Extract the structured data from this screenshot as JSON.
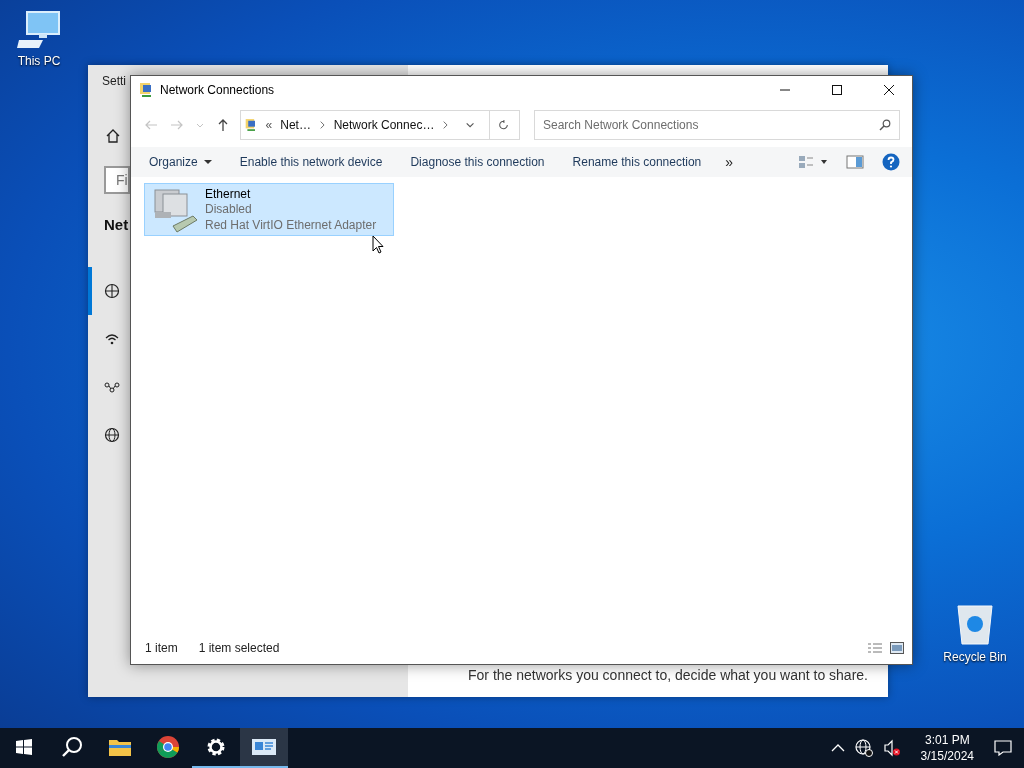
{
  "desktop_icons": [
    {
      "kind": "computer",
      "label": "This PC"
    },
    {
      "kind": "bin",
      "label": "Recycle Bin"
    }
  ],
  "settings_window": {
    "title": "Setti",
    "search_placeholder": "Fi",
    "heading": "Net",
    "nav_items": [
      {
        "kind": "status",
        "selected": true
      },
      {
        "kind": "wifi",
        "selected": false
      },
      {
        "kind": "vpn",
        "selected": false
      },
      {
        "kind": "globe",
        "selected": false
      }
    ],
    "body_text": "For the networks you connect to, decide what you want to share."
  },
  "window": {
    "title": "Network Connections",
    "path_prefix": "«",
    "breadcrumbs": [
      "Net…",
      "Network Connec…"
    ],
    "search_placeholder": "Search Network Connections",
    "toolbar": [
      "Organize",
      "Enable this network device",
      "Diagnose this connection",
      "Rename this connection"
    ],
    "more": "»",
    "items": [
      {
        "name": "Ethernet",
        "status": "Disabled",
        "device": "Red Hat VirtIO Ethernet Adapter",
        "selected": true
      }
    ],
    "status_bar": {
      "count": "1 item",
      "selection": "1 item selected"
    }
  },
  "taskbar": {
    "apps": [
      {
        "kind": "start",
        "running": false,
        "selected": false
      },
      {
        "kind": "search",
        "running": false,
        "selected": false
      },
      {
        "kind": "folder",
        "running": false,
        "selected": false
      },
      {
        "kind": "browser",
        "running": false,
        "selected": false
      },
      {
        "kind": "settings",
        "running": true,
        "selected": false
      },
      {
        "kind": "network",
        "running": true,
        "selected": true
      }
    ],
    "time": "3:01 PM",
    "date": "3/15/2024"
  }
}
